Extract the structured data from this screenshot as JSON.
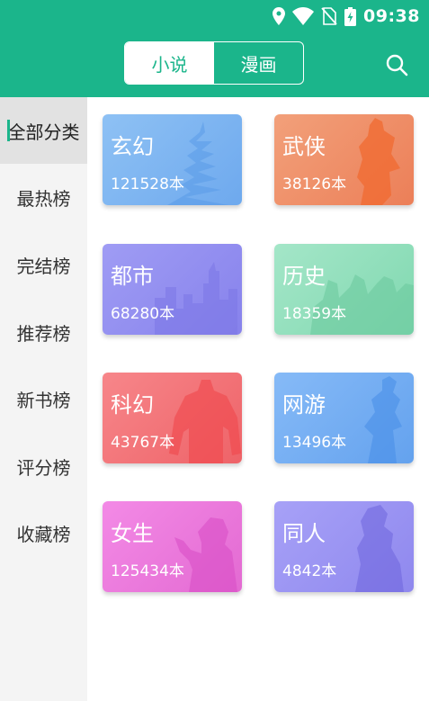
{
  "status_bar": {
    "time": "09:38"
  },
  "header": {
    "tabs": [
      {
        "label": "小说",
        "active": true
      },
      {
        "label": "漫画",
        "active": false
      }
    ],
    "accent_color": "#1bb58b"
  },
  "sidebar": {
    "items": [
      {
        "label": "全部分类",
        "active": true
      },
      {
        "label": "最热榜"
      },
      {
        "label": "完结榜"
      },
      {
        "label": "推荐榜"
      },
      {
        "label": "新书榜"
      },
      {
        "label": "评分榜"
      },
      {
        "label": "收藏榜"
      }
    ]
  },
  "categories": [
    {
      "name": "玄幻",
      "count": "121528本",
      "color_from": "#8ec1f4",
      "color_to": "#6ea9ee"
    },
    {
      "name": "武侠",
      "count": "38126本",
      "color_from": "#f2a07a",
      "color_to": "#ec7f58"
    },
    {
      "name": "都市",
      "count": "68280本",
      "color_from": "#9f9cf4",
      "color_to": "#8782ec"
    },
    {
      "name": "历史",
      "count": "18359本",
      "color_from": "#a4e6c8",
      "color_to": "#80d8b0"
    },
    {
      "name": "科幻",
      "count": "43767本",
      "color_from": "#f7868a",
      "color_to": "#ee6368"
    },
    {
      "name": "网游",
      "count": "13496本",
      "color_from": "#86baf7",
      "color_to": "#64a2ee"
    },
    {
      "name": "女生",
      "count": "125434本",
      "color_from": "#f38ae6",
      "color_to": "#e36ad2"
    },
    {
      "name": "同人",
      "count": "4842本",
      "color_from": "#a7a1f7",
      "color_to": "#8f88ee"
    }
  ]
}
